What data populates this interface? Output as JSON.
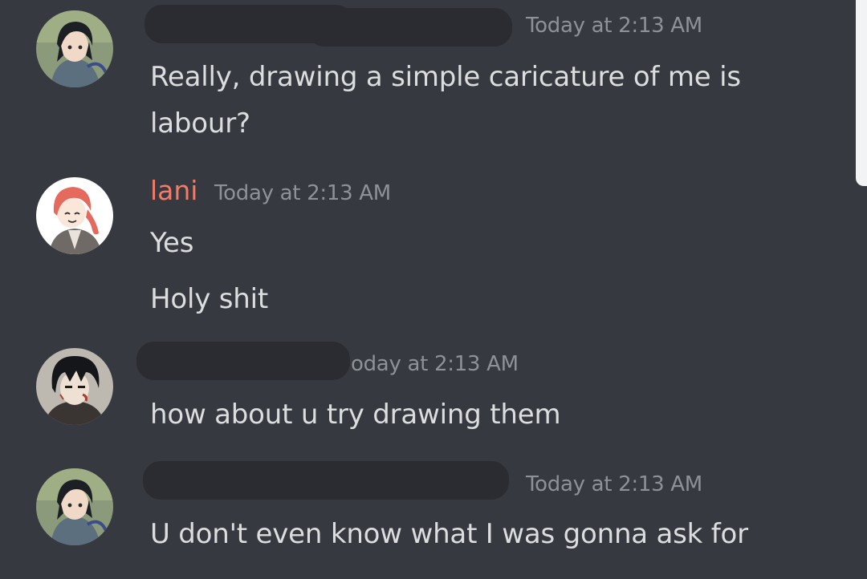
{
  "messages": [
    {
      "username_redacted": true,
      "timestamp": "Today at 2:13 AM",
      "lines": [
        "Really, drawing a simple caricature of me is",
        "labour?"
      ]
    },
    {
      "username": "lani",
      "username_color": "#f47b67",
      "timestamp": "Today at 2:13 AM",
      "lines": [
        "Yes",
        "Holy shit"
      ]
    },
    {
      "username_redacted": true,
      "timestamp": "oday at 2:13 AM",
      "lines": [
        "how about u try drawing them"
      ]
    },
    {
      "username_redacted": true,
      "timestamp": "Today at 2:13 AM",
      "lines": [
        "U don't even know what I was gonna ask for"
      ]
    }
  ],
  "icons": {
    "avatar_1": "anime-girl-avatar-icon",
    "avatar_2": "red-haired-anime-avatar-icon",
    "avatar_3": "dark-haired-anime-boy-avatar-icon"
  },
  "theme": {
    "background": "#36393f",
    "text": "#dcddde",
    "timestamp": "#8e9297",
    "redaction": "#2a2c31"
  }
}
